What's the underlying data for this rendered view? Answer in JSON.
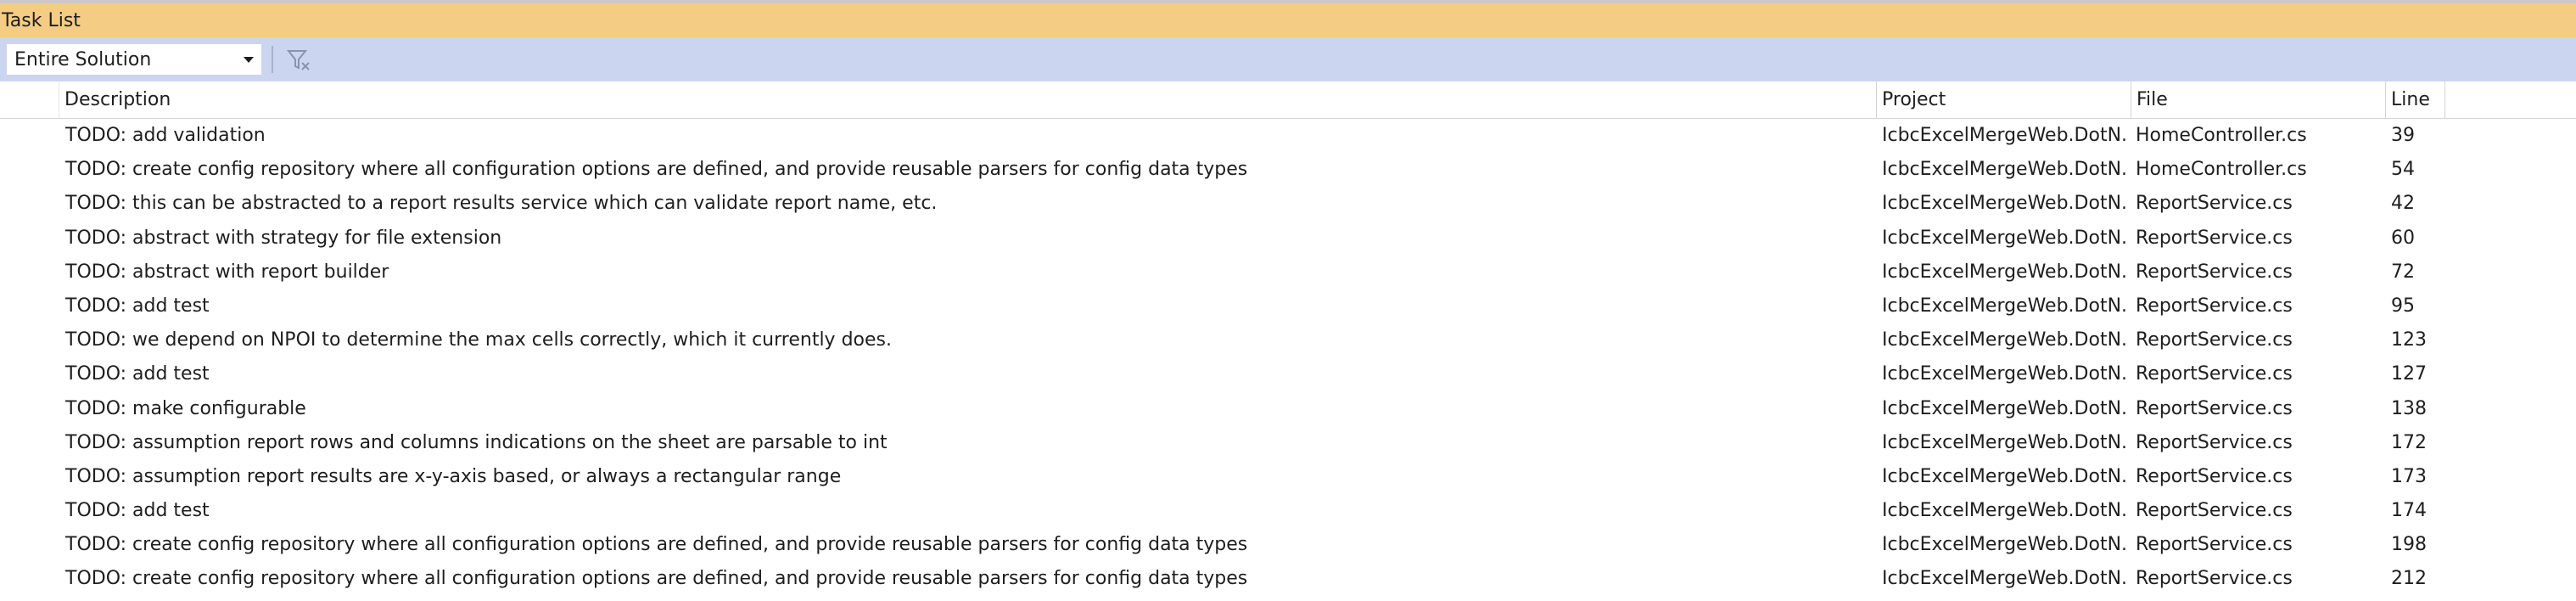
{
  "window": {
    "title": "Task List"
  },
  "toolbar": {
    "scope_value": "Entire Solution",
    "filter_icon": "filter-icon"
  },
  "columns": {
    "description": "Description",
    "project": "Project",
    "file": "File",
    "line": "Line"
  },
  "tasks": [
    {
      "description": "TODO: add validation",
      "project": "IcbcExcelMergeWeb.DotN...",
      "file": "HomeController.cs",
      "line": "39"
    },
    {
      "description": "TODO: create config repository where all configuration options are defined, and provide reusable parsers for config data types",
      "project": "IcbcExcelMergeWeb.DotN...",
      "file": "HomeController.cs",
      "line": "54"
    },
    {
      "description": "TODO: this can be abstracted to a report results service which can validate report name, etc.",
      "project": "IcbcExcelMergeWeb.DotN...",
      "file": "ReportService.cs",
      "line": "42"
    },
    {
      "description": "TODO: abstract with strategy for file extension",
      "project": "IcbcExcelMergeWeb.DotN...",
      "file": "ReportService.cs",
      "line": "60"
    },
    {
      "description": "TODO: abstract with report builder",
      "project": "IcbcExcelMergeWeb.DotN...",
      "file": "ReportService.cs",
      "line": "72"
    },
    {
      "description": "TODO: add test",
      "project": "IcbcExcelMergeWeb.DotN...",
      "file": "ReportService.cs",
      "line": "95"
    },
    {
      "description": "TODO: we depend on NPOI to determine the max cells correctly, which it currently does.",
      "project": "IcbcExcelMergeWeb.DotN...",
      "file": "ReportService.cs",
      "line": "123"
    },
    {
      "description": "TODO: add test",
      "project": "IcbcExcelMergeWeb.DotN...",
      "file": "ReportService.cs",
      "line": "127"
    },
    {
      "description": "TODO: make configurable",
      "project": "IcbcExcelMergeWeb.DotN...",
      "file": "ReportService.cs",
      "line": "138"
    },
    {
      "description": "TODO: assumption report rows and columns indications on the sheet are parsable to int",
      "project": "IcbcExcelMergeWeb.DotN...",
      "file": "ReportService.cs",
      "line": "172"
    },
    {
      "description": "TODO: assumption report results are x-y-axis based, or always a rectangular range",
      "project": "IcbcExcelMergeWeb.DotN...",
      "file": "ReportService.cs",
      "line": "173"
    },
    {
      "description": "TODO: add test",
      "project": "IcbcExcelMergeWeb.DotN...",
      "file": "ReportService.cs",
      "line": "174"
    },
    {
      "description": "TODO: create config repository where all configuration options are defined, and provide reusable parsers for config data types",
      "project": "IcbcExcelMergeWeb.DotN...",
      "file": "ReportService.cs",
      "line": "198"
    },
    {
      "description": "TODO: create config repository where all configuration options are defined, and provide reusable parsers for config data types",
      "project": "IcbcExcelMergeWeb.DotN...",
      "file": "ReportService.cs",
      "line": "212"
    }
  ],
  "colors": {
    "title_bar": "#f5cc84",
    "toolbar": "#ccd5f0"
  }
}
